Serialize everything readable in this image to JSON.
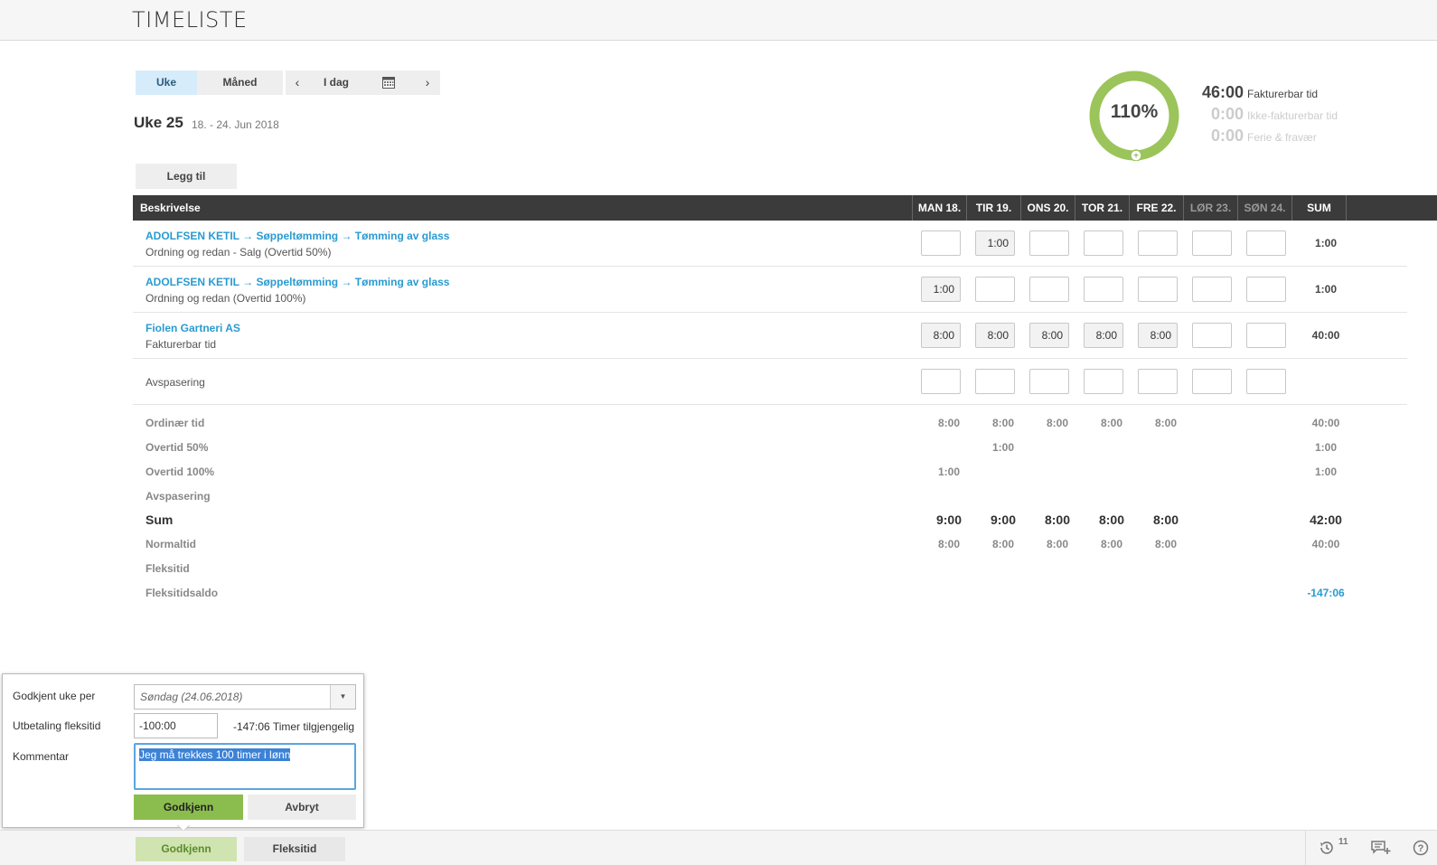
{
  "page": {
    "title": "TIMELISTE"
  },
  "view_toggle": {
    "week": "Uke",
    "month": "Måned"
  },
  "date_nav": {
    "prev": "‹",
    "today": "I dag",
    "next": "›"
  },
  "week": {
    "label": "Uke 25",
    "range": "18. - 24. Jun 2018"
  },
  "add_button": "Legg til",
  "summary": {
    "percent": "110%",
    "percent_value": 110,
    "colors": {
      "ring": "#9bc45a",
      "ring_bg": "#e3eed3"
    },
    "billable": {
      "value": "46:00",
      "label": "Fakturerbar tid"
    },
    "non_billable": {
      "value": "0:00",
      "label": "Ikke-fakturerbar tid"
    },
    "vacation": {
      "value": "0:00",
      "label": "Ferie & fravær"
    }
  },
  "table": {
    "desc_header": "Beskrivelse",
    "days": [
      "MAN 18.",
      "TIR 19.",
      "ONS 20.",
      "TOR 21.",
      "FRE 22.",
      "LØR 23.",
      "SØN 24."
    ],
    "sum_header": "SUM",
    "rows": [
      {
        "title": "ADOLFSEN KETIL → Søppeltømming → Tømming av glass",
        "sub": "Ordning og redan - Salg (Overtid 50%)",
        "cells": [
          "",
          "1:00",
          "",
          "",
          "",
          "",
          ""
        ],
        "sum": "1:00"
      },
      {
        "title": "ADOLFSEN KETIL → Søppeltømming → Tømming av glass",
        "sub": "Ordning og redan (Overtid 100%)",
        "cells": [
          "1:00",
          "",
          "",
          "",
          "",
          "",
          ""
        ],
        "sum": "1:00"
      },
      {
        "title": "Fiolen Gartneri AS",
        "sub": "Fakturerbar tid",
        "cells": [
          "8:00",
          "8:00",
          "8:00",
          "8:00",
          "8:00",
          "",
          ""
        ],
        "sum": "40:00"
      },
      {
        "title": "",
        "sub": "Avspasering",
        "cells": [
          "",
          "",
          "",
          "",
          "",
          "",
          ""
        ],
        "sum": ""
      }
    ],
    "totals": [
      {
        "label": "Ordinær tid",
        "values": [
          "8:00",
          "8:00",
          "8:00",
          "8:00",
          "8:00",
          "",
          ""
        ],
        "sum": "40:00"
      },
      {
        "label": "Overtid 50%",
        "values": [
          "",
          "1:00",
          "",
          "",
          "",
          "",
          ""
        ],
        "sum": "1:00"
      },
      {
        "label": "Overtid 100%",
        "values": [
          "1:00",
          "",
          "",
          "",
          "",
          "",
          ""
        ],
        "sum": "1:00"
      },
      {
        "label": "Avspasering",
        "values": [
          "",
          "",
          "",
          "",
          "",
          "",
          ""
        ],
        "sum": ""
      },
      {
        "label": "Sum",
        "values": [
          "9:00",
          "9:00",
          "8:00",
          "8:00",
          "8:00",
          "",
          ""
        ],
        "sum": "42:00"
      },
      {
        "label": "Normaltid",
        "values": [
          "8:00",
          "8:00",
          "8:00",
          "8:00",
          "8:00",
          "",
          ""
        ],
        "sum": "40:00"
      },
      {
        "label": "Fleksitid",
        "values": [
          "",
          "",
          "",
          "",
          "",
          "",
          ""
        ],
        "sum": ""
      },
      {
        "label": "Fleksitidsaldo",
        "values": [
          "",
          "",
          "",
          "",
          "",
          "",
          ""
        ],
        "sum": "-147:06"
      }
    ]
  },
  "approve_popup": {
    "approved_label": "Godkjent uke per",
    "approved_value": "Søndag (24.06.2018)",
    "payout_label": "Utbetaling fleksitid",
    "payout_value": "-100:00",
    "available_value": "-147:06",
    "available_label": "Timer tilgjengelig",
    "comment_label": "Kommentar",
    "comment_value": "Jeg må trekkes 100 timer i lønn",
    "ok": "Godkjenn",
    "cancel": "Avbryt"
  },
  "footer": {
    "approve": "Godkjenn",
    "flex": "Fleksitid",
    "history_count": "11",
    "icons": [
      "history-icon",
      "add-comment-icon",
      "help-icon"
    ]
  }
}
